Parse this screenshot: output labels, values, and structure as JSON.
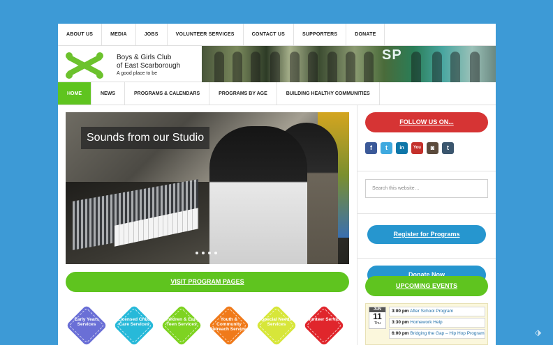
{
  "topnav": [
    "ABOUT US",
    "MEDIA",
    "JOBS",
    "VOLUNTEER SERVICES",
    "CONTACT US",
    "SUPPORTERS",
    "DONATE"
  ],
  "header": {
    "org_line1": "Boys & Girls Club",
    "org_line2": "of East Scarborough",
    "tagline": "A good place to be",
    "banner_text": "SP"
  },
  "mainnav": [
    "HOME",
    "NEWS",
    "PROGRAMS & CALENDARS",
    "PROGRAMS BY AGE",
    "BUILDING HEALTHY COMMUNITIES"
  ],
  "slider": {
    "caption": "Sounds from our Studio",
    "dots": 4
  },
  "visit_button": "VISIT PROGRAM PAGES",
  "services": [
    {
      "label": "Early Years Services",
      "color": "#6a6fd6"
    },
    {
      "label": "Licensed Child Care Services",
      "color": "#27b9d9"
    },
    {
      "label": "Children & Early Teen Services",
      "color": "#7ed321"
    },
    {
      "label": "Youth & Community Outreach Services",
      "color": "#f07a1a"
    },
    {
      "label": "Special Needs Services",
      "color": "#d7e63a"
    },
    {
      "label": "Volunteer Services",
      "color": "#e0262c"
    }
  ],
  "sidebar": {
    "follow_label": "FOLLOW US ON...",
    "social": [
      {
        "icon": "facebook-icon",
        "glyph": "f",
        "color": "#3b5998"
      },
      {
        "icon": "twitter-icon",
        "glyph": "t",
        "color": "#3fa9df"
      },
      {
        "icon": "linkedin-icon",
        "glyph": "in",
        "color": "#0e76a8"
      },
      {
        "icon": "youtube-icon",
        "glyph": "You",
        "color": "#c4302b"
      },
      {
        "icon": "instagram-icon",
        "glyph": "◙",
        "color": "#5b4a3c"
      },
      {
        "icon": "tumblr-icon",
        "glyph": "t",
        "color": "#3b566e"
      }
    ],
    "search_placeholder": "Search this website…",
    "register_label": "Register for Programs",
    "donate_label": "Donate Now",
    "events_label": "UPCOMING EVENTS",
    "calendar": {
      "month": "JUN",
      "day": "11",
      "weekday": "Thu"
    },
    "events": [
      {
        "time": "3:00 pm",
        "title": "After School Program"
      },
      {
        "time": "3:30 pm",
        "title": "Homework Help"
      },
      {
        "time": "6:00 pm",
        "title": "Bridging the Gap – Hip Hop Program"
      }
    ]
  }
}
